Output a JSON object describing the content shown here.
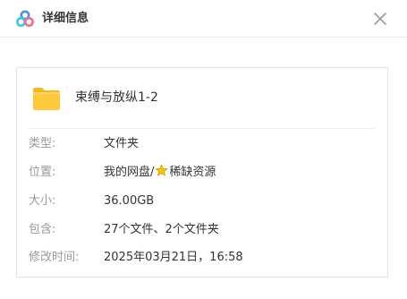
{
  "header": {
    "title": "详细信息",
    "logo_icon": "cloud-drive-logo-icon",
    "close_icon": "close-icon"
  },
  "file": {
    "icon": "folder-icon",
    "name": "束缚与放纵1-2"
  },
  "details": {
    "type_label": "类型:",
    "type_value": "文件夹",
    "location_label": "位置:",
    "location_prefix": "我的网盘/",
    "location_star_icon": "star-icon",
    "location_suffix": "稀缺资源",
    "size_label": "大小:",
    "size_value": "36.00GB",
    "contains_label": "包含:",
    "contains_value": "27个文件、2个文件夹",
    "modified_label": "修改时间:",
    "modified_value": "2025年03月21日，16:58"
  },
  "colors": {
    "folder": "#FFC93C",
    "star": "#F5C518",
    "logo_blue": "#4A90E2",
    "logo_pink": "#F06E93",
    "logo_cyan": "#3EC6E0"
  }
}
